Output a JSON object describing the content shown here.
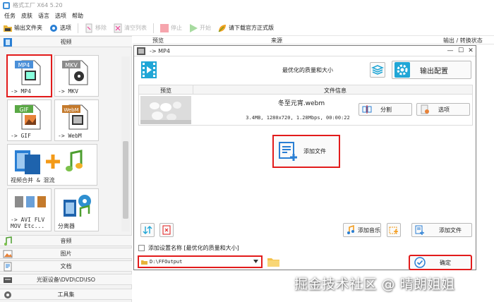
{
  "app": {
    "title": "格式工厂 X64 5.20"
  },
  "menu": [
    "任务",
    "皮肤",
    "语言",
    "选项",
    "帮助"
  ],
  "toolbar": {
    "output_folder": "输出文件夹",
    "options": "选项",
    "remove": "移除",
    "clear_list": "清空列表",
    "stop": "停止",
    "start": "开始",
    "download": "请下载官方正式版"
  },
  "sidebar": {
    "video_header": "视频",
    "audio_header": "音频",
    "image_header": "图片",
    "document_header": "文档",
    "disc_header": "光驱设备\\DVD\\CD\\ISO",
    "tools_header": "工具集",
    "tiles": {
      "mp4": "-> MP4",
      "mkv": "-> MKV",
      "gif": "-> GIF",
      "webm": "-> WebM",
      "merge": "视频合并 & 混流",
      "avi_line1": "-> AVI FLV",
      "avi_line2": "MOV Etc...",
      "splitter": "分离器"
    },
    "icon_badges": {
      "mp4": "MP4",
      "mkv": "MKV",
      "gif": "GIF",
      "webm": "WebM"
    }
  },
  "columns": {
    "preview": "预览",
    "source": "来源",
    "output_status": "输出 / 转换状态"
  },
  "dialog": {
    "title": "-> MP4",
    "profile": "最优化的质量和大小",
    "output_config": "输出配置",
    "table_headers": {
      "preview": "预览",
      "file_info": "文件信息"
    },
    "file": {
      "name": "冬至元宵.webm",
      "info": "3.4MB, 1280x720, 1.28Mbps, 00:00:22",
      "split": "分割",
      "options": "选项"
    },
    "add_file_big": "添加文件",
    "add_music": "添加音乐",
    "add_file": "添加文件",
    "add_setting_name": "添加设置名称 [最优化的质量和大小]",
    "output_path": "D:\\FFOutput",
    "ok": "确定"
  },
  "watermark": "掘金技术社区 @ 晴朗姐姐",
  "colors": {
    "highlight": "#e21b1b",
    "accent_blue": "#2a7fd4",
    "cyan": "#20a6d6"
  }
}
